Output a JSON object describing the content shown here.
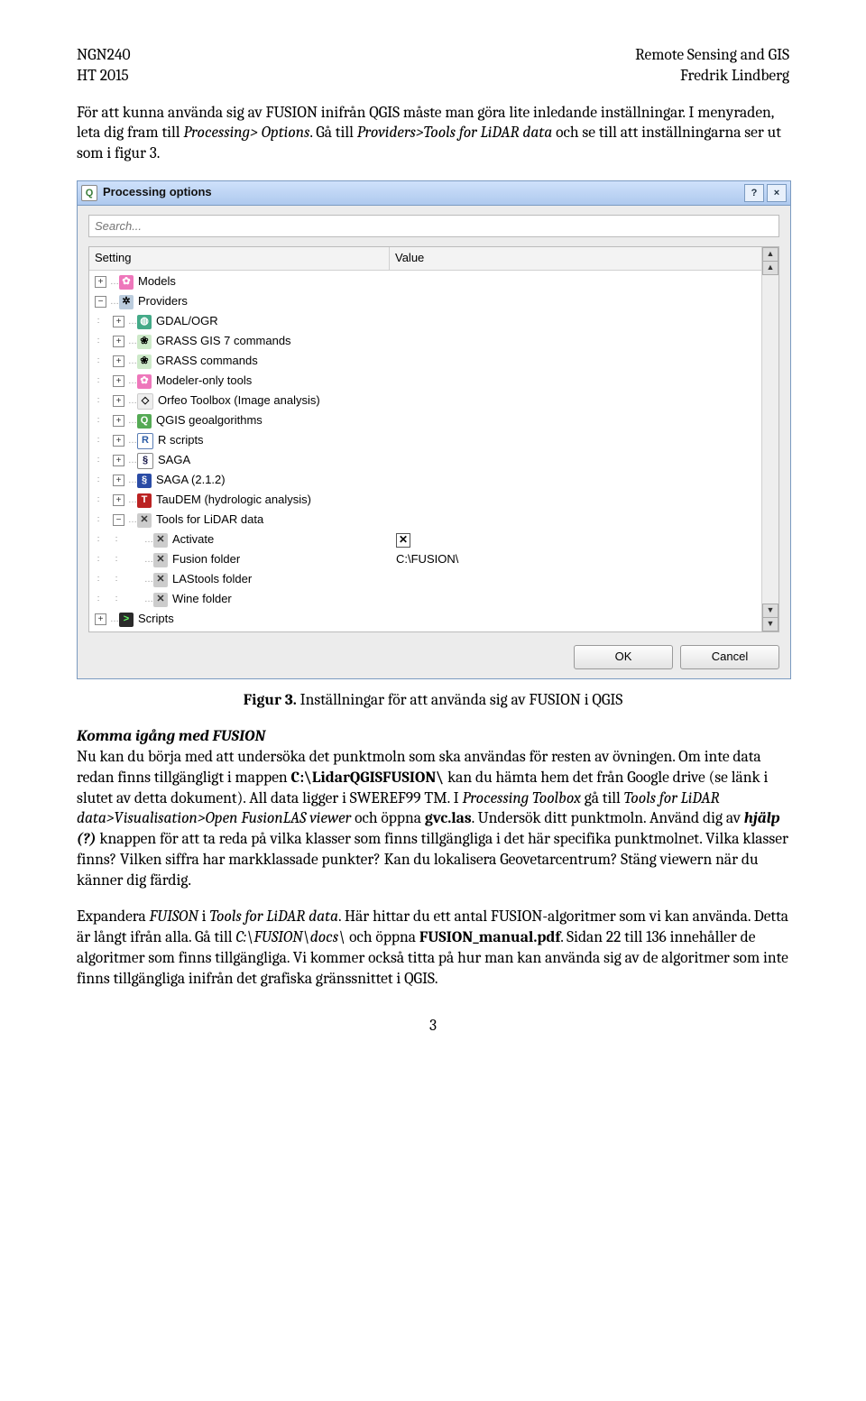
{
  "header": {
    "left1": "NGN240",
    "left2": "HT 2015",
    "right1": "Remote Sensing and GIS",
    "right2": "Fredrik Lindberg"
  },
  "p1": {
    "t1": "För att kunna använda sig av FUSION inifrån QGIS måste man göra lite inledande inställningar. I menyraden, leta dig fram till ",
    "i1": "Processing> Options",
    "t2": ". Gå till ",
    "i2": "Providers>Tools for LiDAR data",
    "t3": " och se till att inställningarna ser ut som i figur 3."
  },
  "dialog": {
    "title": "Processing options",
    "help_btn": "?",
    "close_btn": "×",
    "search_placeholder": "Search...",
    "columns": {
      "setting": "Setting",
      "value": "Value"
    },
    "tree": [
      {
        "exp": "+",
        "indent": 0,
        "icon": "model",
        "glyph": "✿",
        "label": "Models"
      },
      {
        "exp": "−",
        "indent": 0,
        "icon": "gear",
        "glyph": "✲",
        "label": "Providers"
      },
      {
        "exp": "+",
        "indent": 1,
        "icon": "globe",
        "glyph": "◍",
        "label": "GDAL/OGR"
      },
      {
        "exp": "+",
        "indent": 1,
        "icon": "grass",
        "glyph": "❀",
        "label": "GRASS GIS 7 commands"
      },
      {
        "exp": "+",
        "indent": 1,
        "icon": "grass",
        "glyph": "❀",
        "label": "GRASS commands"
      },
      {
        "exp": "+",
        "indent": 1,
        "icon": "model",
        "glyph": "✿",
        "label": "Modeler-only tools"
      },
      {
        "exp": "+",
        "indent": 1,
        "icon": "orfeo",
        "glyph": "◇",
        "label": "Orfeo Toolbox (Image analysis)"
      },
      {
        "exp": "+",
        "indent": 1,
        "icon": "qgis",
        "glyph": "Q",
        "label": "QGIS geoalgorithms"
      },
      {
        "exp": "+",
        "indent": 1,
        "icon": "r",
        "glyph": "R",
        "label": "R scripts"
      },
      {
        "exp": "+",
        "indent": 1,
        "icon": "saga",
        "glyph": "§",
        "label": "SAGA"
      },
      {
        "exp": "+",
        "indent": 1,
        "icon": "saga2",
        "glyph": "§",
        "label": "SAGA (2.1.2)"
      },
      {
        "exp": "+",
        "indent": 1,
        "icon": "tau",
        "glyph": "T",
        "label": "TauDEM (hydrologic analysis)"
      },
      {
        "exp": "−",
        "indent": 1,
        "icon": "tool",
        "glyph": "✕",
        "label": "Tools for LiDAR data"
      },
      {
        "exp": "",
        "indent": 2,
        "icon": "tool",
        "glyph": "✕",
        "label": "Activate",
        "value_type": "check",
        "value": "✕"
      },
      {
        "exp": "",
        "indent": 2,
        "icon": "tool",
        "glyph": "✕",
        "label": "Fusion folder",
        "value_type": "text",
        "value": "C:\\FUSION\\"
      },
      {
        "exp": "",
        "indent": 2,
        "icon": "tool",
        "glyph": "✕",
        "label": "LAStools folder"
      },
      {
        "exp": "",
        "indent": 2,
        "icon": "tool",
        "glyph": "✕",
        "label": "Wine folder"
      },
      {
        "exp": "+",
        "indent": 0,
        "icon": "script",
        "glyph": ">",
        "label": "Scripts"
      }
    ],
    "ok": "OK",
    "cancel": "Cancel"
  },
  "figcap": {
    "b": "Figur 3.",
    "t": " Inställningar för att använda sig av FUSION i QGIS"
  },
  "s2": {
    "heading": "Komma igång med FUSION",
    "t1": "Nu kan du börja med att undersöka det punktmoln som ska användas för resten av övningen. Om inte data redan finns tillgängligt i mappen ",
    "b1": "C:\\LidarQGISFUSION\\",
    "t2": " kan du hämta hem det från Google drive (se länk i slutet av detta dokument). All data ligger i SWEREF99 TM. I ",
    "i1": "Processing Toolbox",
    "t3": " gå till ",
    "i2": "Tools for LiDAR data>Visualisation>Open FusionLAS viewer",
    "t4": " och öppna ",
    "b2": "gvc.las",
    "t5": ". Undersök ditt punktmoln. Använd dig av ",
    "bi1": "hjälp (?)",
    "t6": " knappen för att ta reda på vilka klasser som finns tillgängliga i det här specifika punktmolnet. Vilka klasser finns? Vilken siffra har markklassade punkter? Kan du lokalisera Geovetarcentrum? Stäng viewern när du känner dig färdig."
  },
  "s3": {
    "t1": "Expandera ",
    "i1": "FUISON",
    "t2": " i ",
    "i2": "Tools for LiDAR data",
    "t3": ". Här hittar du ett antal FUSION-algoritmer som vi kan använda. Detta är långt ifrån alla. Gå till ",
    "i3": "C:\\FUSION\\docs\\",
    "t4": " och öppna ",
    "b1": "FUSION_manual.pdf",
    "t5": ". Sidan 22 till 136 innehåller de algoritmer som finns tillgängliga. Vi kommer också titta på hur man kan använda sig av de algoritmer som inte finns tillgängliga inifrån det grafiska gränssnittet i QGIS."
  },
  "page_num": "3"
}
